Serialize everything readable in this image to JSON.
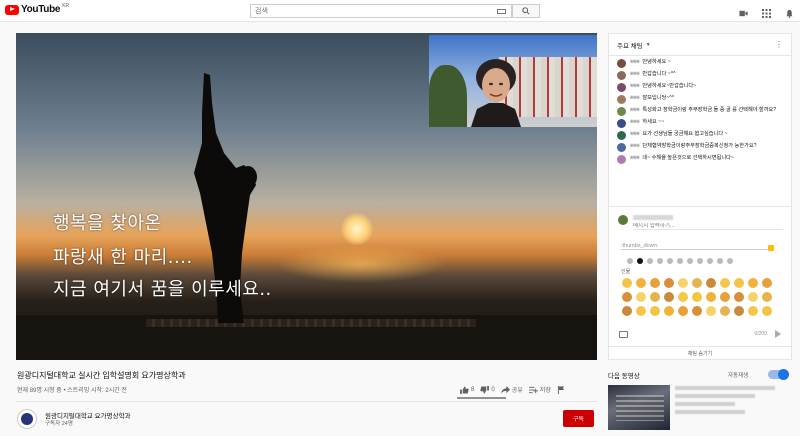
{
  "header": {
    "logo_text": "YouTube",
    "logo_region": "KR",
    "search_placeholder": "검색"
  },
  "video": {
    "subtitles": [
      "행복을 찾아온",
      "파랑새  한 마리....",
      "지금 여기서 꿈을 이루세요.."
    ],
    "title": "원광디지털대학교 실시간 입학설명회 요가명상학과",
    "views": "현재 89명 시청 중 • 스트리밍 시작: 2시간 전",
    "likes": "8",
    "dislikes": "0",
    "share_label": "공유",
    "save_label": "저장"
  },
  "channel": {
    "name": "원광디지털대학교 요가명상학과",
    "subscribers": "구독자 24명",
    "subscribe_label": "구독"
  },
  "chat": {
    "header_label": "주요 채팅",
    "messages": [
      {
        "name": "",
        "text": "안녕하세요 ~",
        "color": "#7a4a3a"
      },
      {
        "name": "",
        "text": "반갑습니다 ~^^",
        "color": "#8a6a5a"
      },
      {
        "name": "",
        "text": "안녕하세요~반갑습니다~",
        "color": "#7b4b6b"
      },
      {
        "name": "",
        "text": "잘보입니당~^^",
        "color": "#a07a60"
      },
      {
        "name": "",
        "text": "특성화고 장학금이랑 주부장학금 둘 중 골 를 선택해야 할까요?",
        "color": "#6a8a4a"
      },
      {
        "name": "",
        "text": "하세요 ~~",
        "color": "#3a4a8a"
      },
      {
        "name": "",
        "text": "요가 선생님들 궁금해요 뵙고싶습니다 ~",
        "color": "#2a6a4a"
      },
      {
        "name": "",
        "text": "단체협약장학금이랑주부장학금중복신청가 능한가요?",
        "color": "#4a6aa0"
      },
      {
        "name": "",
        "text": "네~ 수해율 높은것으로 선택하시면됩니다~",
        "color": "#b07ab0"
      }
    ],
    "input_placeholder": "메시지 입력하기...",
    "emoji_search": ":thumbs_down:",
    "emoji_section_label": "인물",
    "char_count": "0/200",
    "hide_chat_label": "채팅 숨기기"
  },
  "sidebar": {
    "up_next_label": "다음 동영상",
    "autoplay_label": "자동재생"
  },
  "colors": {
    "brand_red": "#ff0000",
    "subscribe_red": "#cc0000",
    "autoplay_blue": "#1a73e8"
  }
}
